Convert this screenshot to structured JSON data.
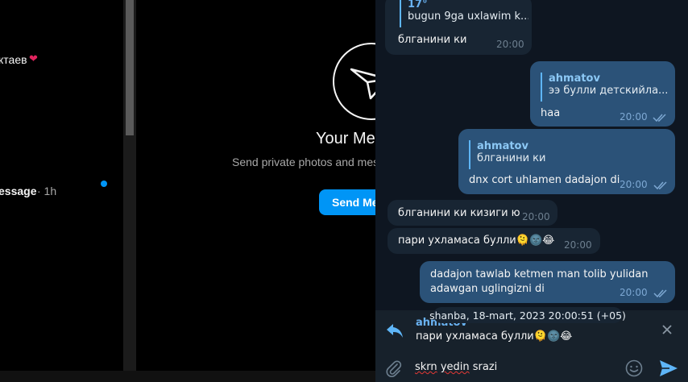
{
  "instagram": {
    "conversation_1_name": "ктаев",
    "conversation_1_emoji": "❤",
    "conversation_2_preview": "essage",
    "conversation_2_time": "· 1h",
    "empty_title": "Your Me",
    "empty_subtitle": "Send private photos and mes",
    "send_button": "Send Me",
    "accent_color": "#0095f6"
  },
  "chat": {
    "messages": [
      {
        "reply_name": "17°",
        "reply_text": "bugun 9ga uxlawim k...",
        "text": "блганини ки",
        "time": "20:00",
        "direction": "in"
      },
      {
        "reply_name": "ahmatov",
        "reply_text": "ээ булли детскийла...",
        "text": "haa",
        "time": "20:00",
        "direction": "out"
      },
      {
        "reply_name": "ahmatov",
        "reply_text": "блганини ки",
        "text": "dnx cort uhlamen dadajon di",
        "time": "20:00",
        "direction": "out"
      },
      {
        "text": "блганини ки кизиги ю",
        "time": "20:00",
        "direction": "in"
      },
      {
        "text": "пари ухламаса булли🫠🌚😂",
        "time": "20:00",
        "direction": "in"
      },
      {
        "text_line1": "dadajon tawlab ketmen man tolib yulidan",
        "text_line2": "adawgan uglingizni di",
        "time": "20:00",
        "direction": "out"
      }
    ],
    "date_tooltip": "shanba, 18-mart, 2023 20:00:51 (+05)"
  },
  "composer": {
    "reply_name": "ahmatov",
    "reply_text": "пари ухламаса булли🫠🌚😂",
    "input_word_1": "skrn",
    "input_space_1": " ",
    "input_word_2": "yedin",
    "input_rest": " srazi",
    "icons": [
      "reply-arrow-icon",
      "close-icon",
      "paperclip-icon",
      "emoji-icon",
      "send-icon"
    ]
  },
  "colors": {
    "chat_background": "#0e1621",
    "incoming_bubble": "#182533",
    "outgoing_bubble": "#2b5278",
    "link_blue": "#6ab3f3"
  }
}
